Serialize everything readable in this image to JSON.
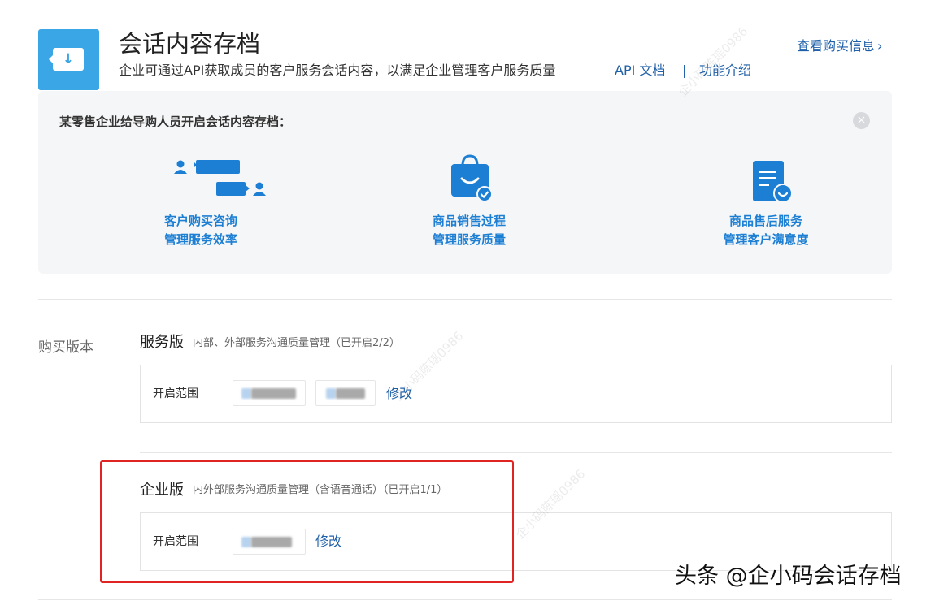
{
  "header": {
    "title": "会话内容存档",
    "description": "企业可通过API获取成员的客户服务会话内容，以满足企业管理客户服务质量",
    "api_doc_link": "API 文档",
    "separator": "|",
    "feature_link": "功能介绍",
    "purchase_info_link": "查看购买信息",
    "purchase_info_chevron": "›",
    "app_icon": "archive-download-icon",
    "app_icon_glyph": "↓"
  },
  "promo": {
    "title": "某零售企业给导购人员开启会话内容存档：",
    "close_glyph": "×",
    "features": [
      {
        "icon": "chat-consult-icon",
        "line1": "客户购买咨询",
        "line2": "管理服务效率"
      },
      {
        "icon": "shopping-bag-icon",
        "line1": "商品销售过程",
        "line2": "管理服务质量"
      },
      {
        "icon": "after-sales-doc-icon",
        "line1": "商品售后服务",
        "line2": "管理客户满意度"
      }
    ]
  },
  "purchase": {
    "label": "购买版本",
    "service_plan": {
      "name": "服务版",
      "description": "内部、外部服务沟通质量管理（已开启2/2）",
      "scope_label": "开启范围",
      "edit_label": "修改"
    },
    "enterprise_plan": {
      "name": "企业版",
      "description": "内外部服务沟通质量管理（含语音通话）（已开启1/1）",
      "scope_label": "开启范围",
      "edit_label": "修改"
    }
  },
  "watermark": {
    "text": "头条 @企小码会话存档",
    "faint": "企小码陈瑶0986"
  },
  "colors": {
    "accent": "#3ba6e6",
    "link": "#1f5fa8",
    "feature_text": "#1d7fd4",
    "highlight_border": "#e02424",
    "card_bg": "#f5f6f7"
  }
}
